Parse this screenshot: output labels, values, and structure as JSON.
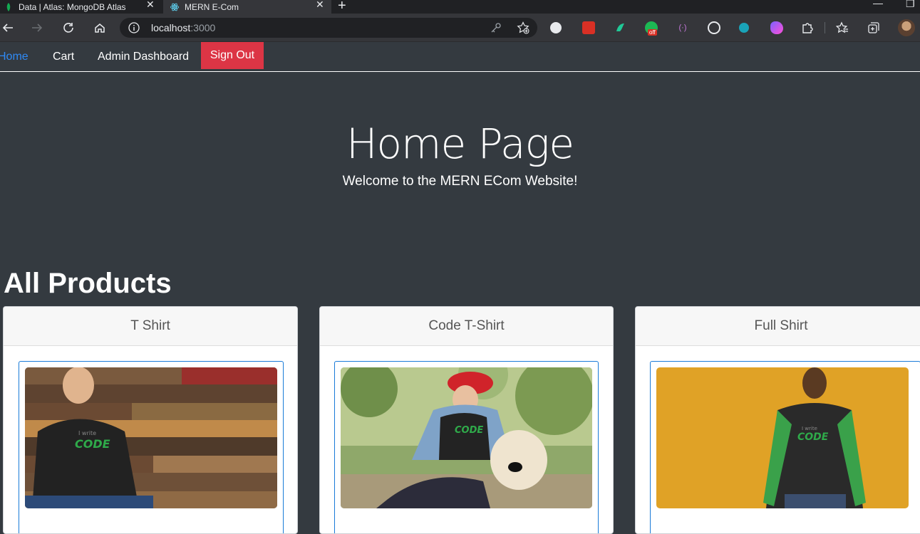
{
  "browser": {
    "tabs": [
      {
        "title": "Data | Atlas: MongoDB Atlas",
        "active": false
      },
      {
        "title": "MERN E-Com",
        "active": true
      }
    ],
    "url_host": "localhost",
    "url_port": ":3000"
  },
  "nav": {
    "home": "Home",
    "cart": "Cart",
    "admin": "Admin Dashboard",
    "signout": "Sign Out"
  },
  "hero": {
    "title": "Home Page",
    "subtitle": "Welcome to the MERN ECom Website!"
  },
  "products": {
    "heading": "All Products",
    "items": [
      {
        "name": "T Shirt"
      },
      {
        "name": "Code T-Shirt"
      },
      {
        "name": "Full Shirt"
      }
    ]
  },
  "colors": {
    "page_bg": "#343a40",
    "active_link": "#2f8af5",
    "danger": "#dc3545",
    "frame_border": "#1a7bd8"
  }
}
